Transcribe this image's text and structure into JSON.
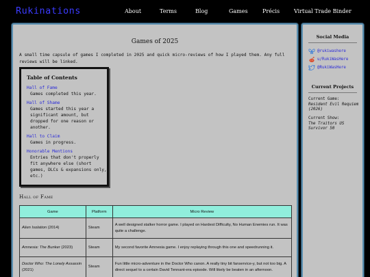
{
  "brand": "Rukinations",
  "nav": [
    {
      "label": "About"
    },
    {
      "label": "Terms"
    },
    {
      "label": "Blog"
    },
    {
      "label": "Games"
    },
    {
      "label": "Précis"
    },
    {
      "label": "Virtual Trade Binder"
    }
  ],
  "page": {
    "title": "Games of 2025",
    "intro": "A small time capsule of games I completed in 2025 and quick micro-reviews of how I played them. Any full reviews will be linked."
  },
  "toc": {
    "title": "Table of Contents",
    "items": [
      {
        "link": "Hall of Fame",
        "desc": "Games completed this year."
      },
      {
        "link": "Hall of Shame",
        "desc": "Games started this year a significant amount, but dropped for one reason or another."
      },
      {
        "link": "Hall to Claim",
        "desc": "Games in progress."
      },
      {
        "link": "Honorable Mentions",
        "desc": "Entries that don't properly fit anywhere else (short games, DLCs & expansions only, etc.)"
      }
    ]
  },
  "section": {
    "title": "Hall of Fame"
  },
  "table": {
    "headers": [
      "Game",
      "Platform",
      "Micro Review"
    ],
    "rows": [
      {
        "title": "Alien Isolation",
        "year": "(2014)",
        "platform": "Steam",
        "review": "A well designed stalker horror game. I played on Hardest Difficulty, No Human Enemies run. It was quite a challenge."
      },
      {
        "title": "Amnesia: The Bunker",
        "year": "(2023)",
        "platform": "Steam",
        "review": "My second favorite Amnesia game. I enjoy replaying through this one and speedrunning it."
      },
      {
        "title": "Doctor Who: The Lonely Assassin",
        "year": "(2021)",
        "platform": "Steam",
        "review": "Fun little micro-adventure in the Doctor Who canon. A really tiny bit fanservice-y, but not too big. A direct sequel to a certain David Tennant-era episode. Will likely be beaten in an afternoon."
      }
    ]
  },
  "sidebar": {
    "social_title": "Social Media",
    "social": [
      {
        "label": "@rukiwashere",
        "icon": "butterfly-icon",
        "color": "#3b7dd8"
      },
      {
        "label": "u/RukiWasHere",
        "icon": "reddit-icon",
        "color": "#d84a2a"
      },
      {
        "label": "@RukiWasHere",
        "icon": "twitter-icon",
        "color": "#3b7dd8"
      }
    ],
    "projects_title": "Current Projects",
    "projects": [
      {
        "label": "Current Game:",
        "value": "Resident Evil Requiem (2026)"
      },
      {
        "label": "Current Show:",
        "value": "The Traitors US Survivor 50"
      }
    ]
  },
  "colors": {
    "accent_link": "#2a2ad8",
    "table_header": "#90eedc",
    "panel": "#c3c3c3",
    "brand": "#3b3bff"
  }
}
